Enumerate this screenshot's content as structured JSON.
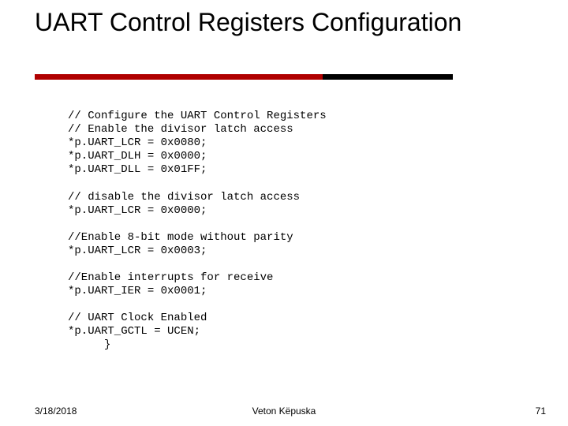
{
  "title": "UART Control Registers Configuration",
  "code": {
    "line1": "// Configure the UART Control Registers",
    "line2": "// Enable the divisor latch access",
    "line3": "*p.UART_LCR = 0x0080;",
    "line4": "*p.UART_DLH = 0x0000;",
    "line5": "*p.UART_DLL = 0x01FF;",
    "blankA": "",
    "line6": "// disable the divisor latch access",
    "line7": "*p.UART_LCR = 0x0000;",
    "blankB": "",
    "line8": "//Enable 8-bit mode without parity",
    "line9": "*p.UART_LCR = 0x0003;",
    "blankC": "",
    "line10": "//Enable interrupts for receive",
    "line11": "*p.UART_IER = 0x0001;",
    "blankD": "",
    "line12": "// UART Clock Enabled",
    "line13": "*p.UART_GCTL = UCEN;",
    "brace": "}"
  },
  "footer": {
    "date": "3/18/2018",
    "author": "Veton Këpuska",
    "page": "71"
  }
}
